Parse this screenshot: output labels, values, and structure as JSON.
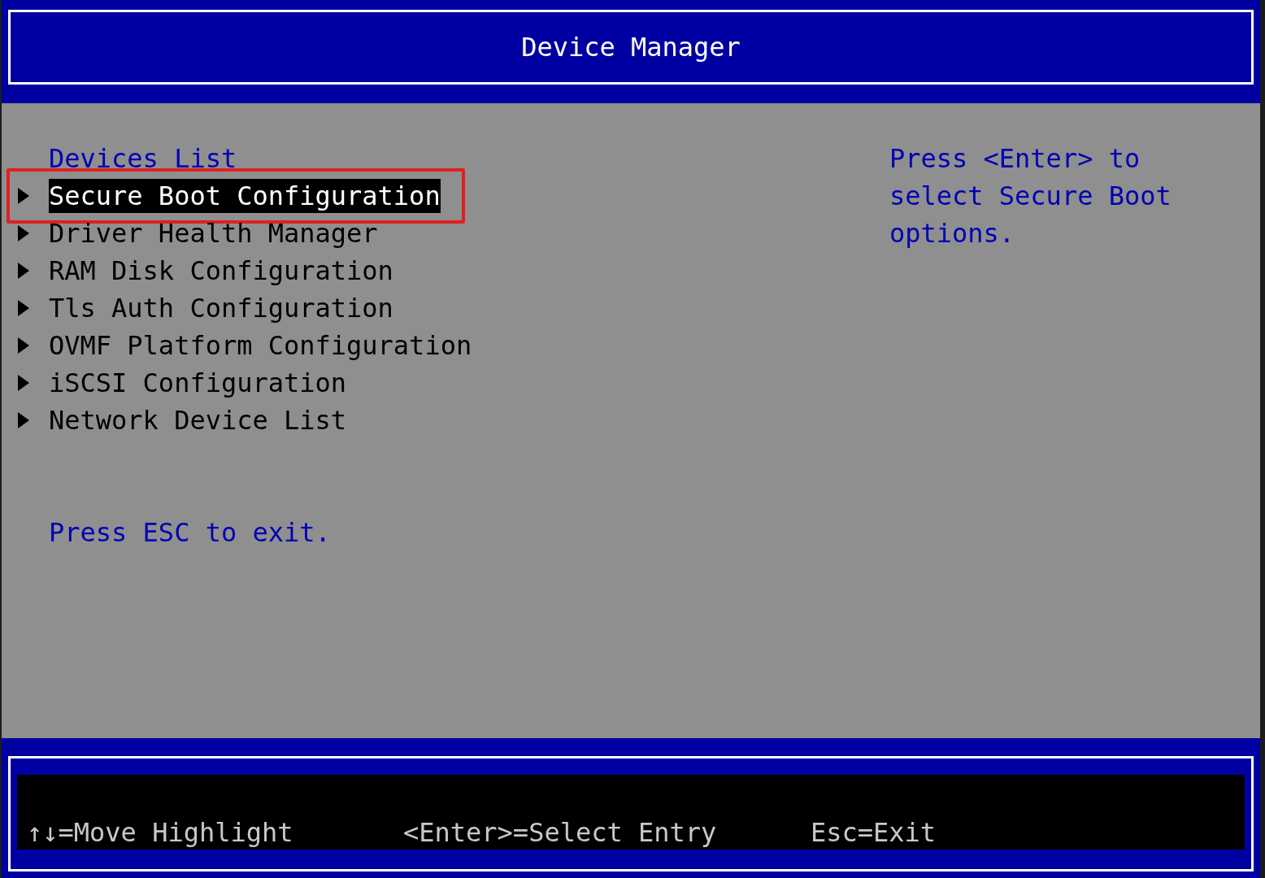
{
  "header": {
    "title": "Device Manager"
  },
  "devices": {
    "heading": "Devices List",
    "items": [
      {
        "label": "Secure Boot Configuration",
        "selected": true,
        "annotated": true
      },
      {
        "label": "Driver Health Manager",
        "selected": false,
        "annotated": false
      },
      {
        "label": "RAM Disk Configuration",
        "selected": false,
        "annotated": false
      },
      {
        "label": "Tls Auth Configuration",
        "selected": false,
        "annotated": false
      },
      {
        "label": "OVMF Platform Configuration",
        "selected": false,
        "annotated": false
      },
      {
        "label": "iSCSI Configuration",
        "selected": false,
        "annotated": false
      },
      {
        "label": "Network Device List",
        "selected": false,
        "annotated": false
      }
    ],
    "exit_hint": "Press ESC to exit."
  },
  "help_text": "Press <Enter> to select Secure Boot options.",
  "footer": {
    "hints": [
      "↑↓=Move Highlight",
      "<Enter>=Select Entry",
      "Esc=Exit"
    ]
  }
}
